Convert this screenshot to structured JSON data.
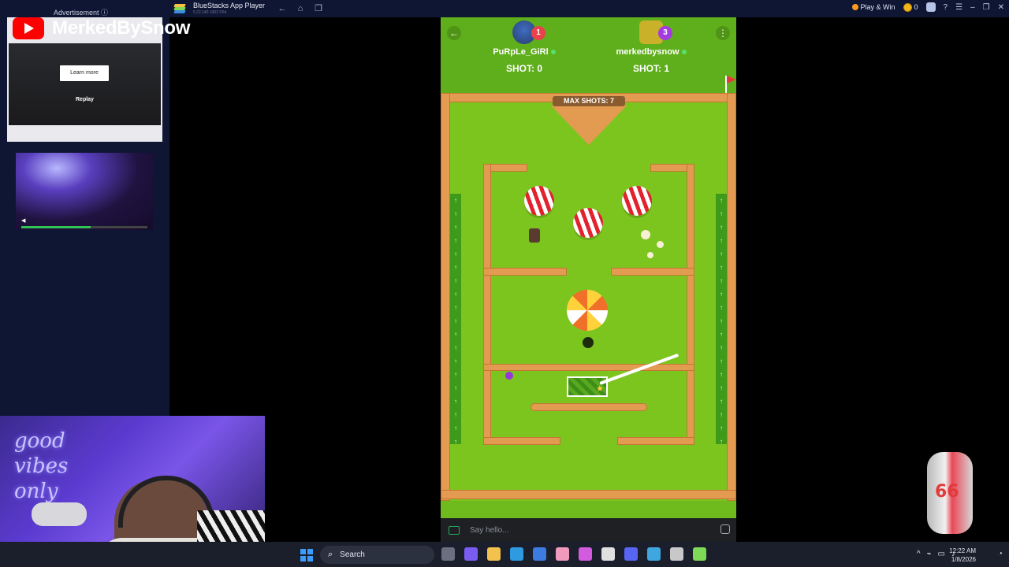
{
  "titlebar": {
    "app_title": "BlueStacks App Player",
    "app_subtitle": "5.22.140.1002 P64",
    "play_win": "Play & Win",
    "coins": "0"
  },
  "ads": {
    "label": "Advertisement ⓘ",
    "learn_more": "Learn more",
    "replay": "Replay"
  },
  "stream": {
    "channel_name": "MerkedBySnow",
    "neon_sign": "good vibes only"
  },
  "game": {
    "player1": {
      "name": "PuRpLe_GiRl",
      "level": "1",
      "shots": "SHOT: 0"
    },
    "player2": {
      "name": "merkedbysnow",
      "level": "3",
      "shots": "SHOT: 1"
    },
    "max_shots": "MAX SHOTS: 7",
    "chat_placeholder": "Say hello..."
  },
  "taskbar": {
    "search": "Search",
    "time": "12:22 AM",
    "date": "1/8/2026"
  },
  "colors": {
    "grass": "#7cc51f",
    "wall": "#e39b52",
    "titlebar": "#0f1633",
    "youtube": "#ff0000"
  }
}
